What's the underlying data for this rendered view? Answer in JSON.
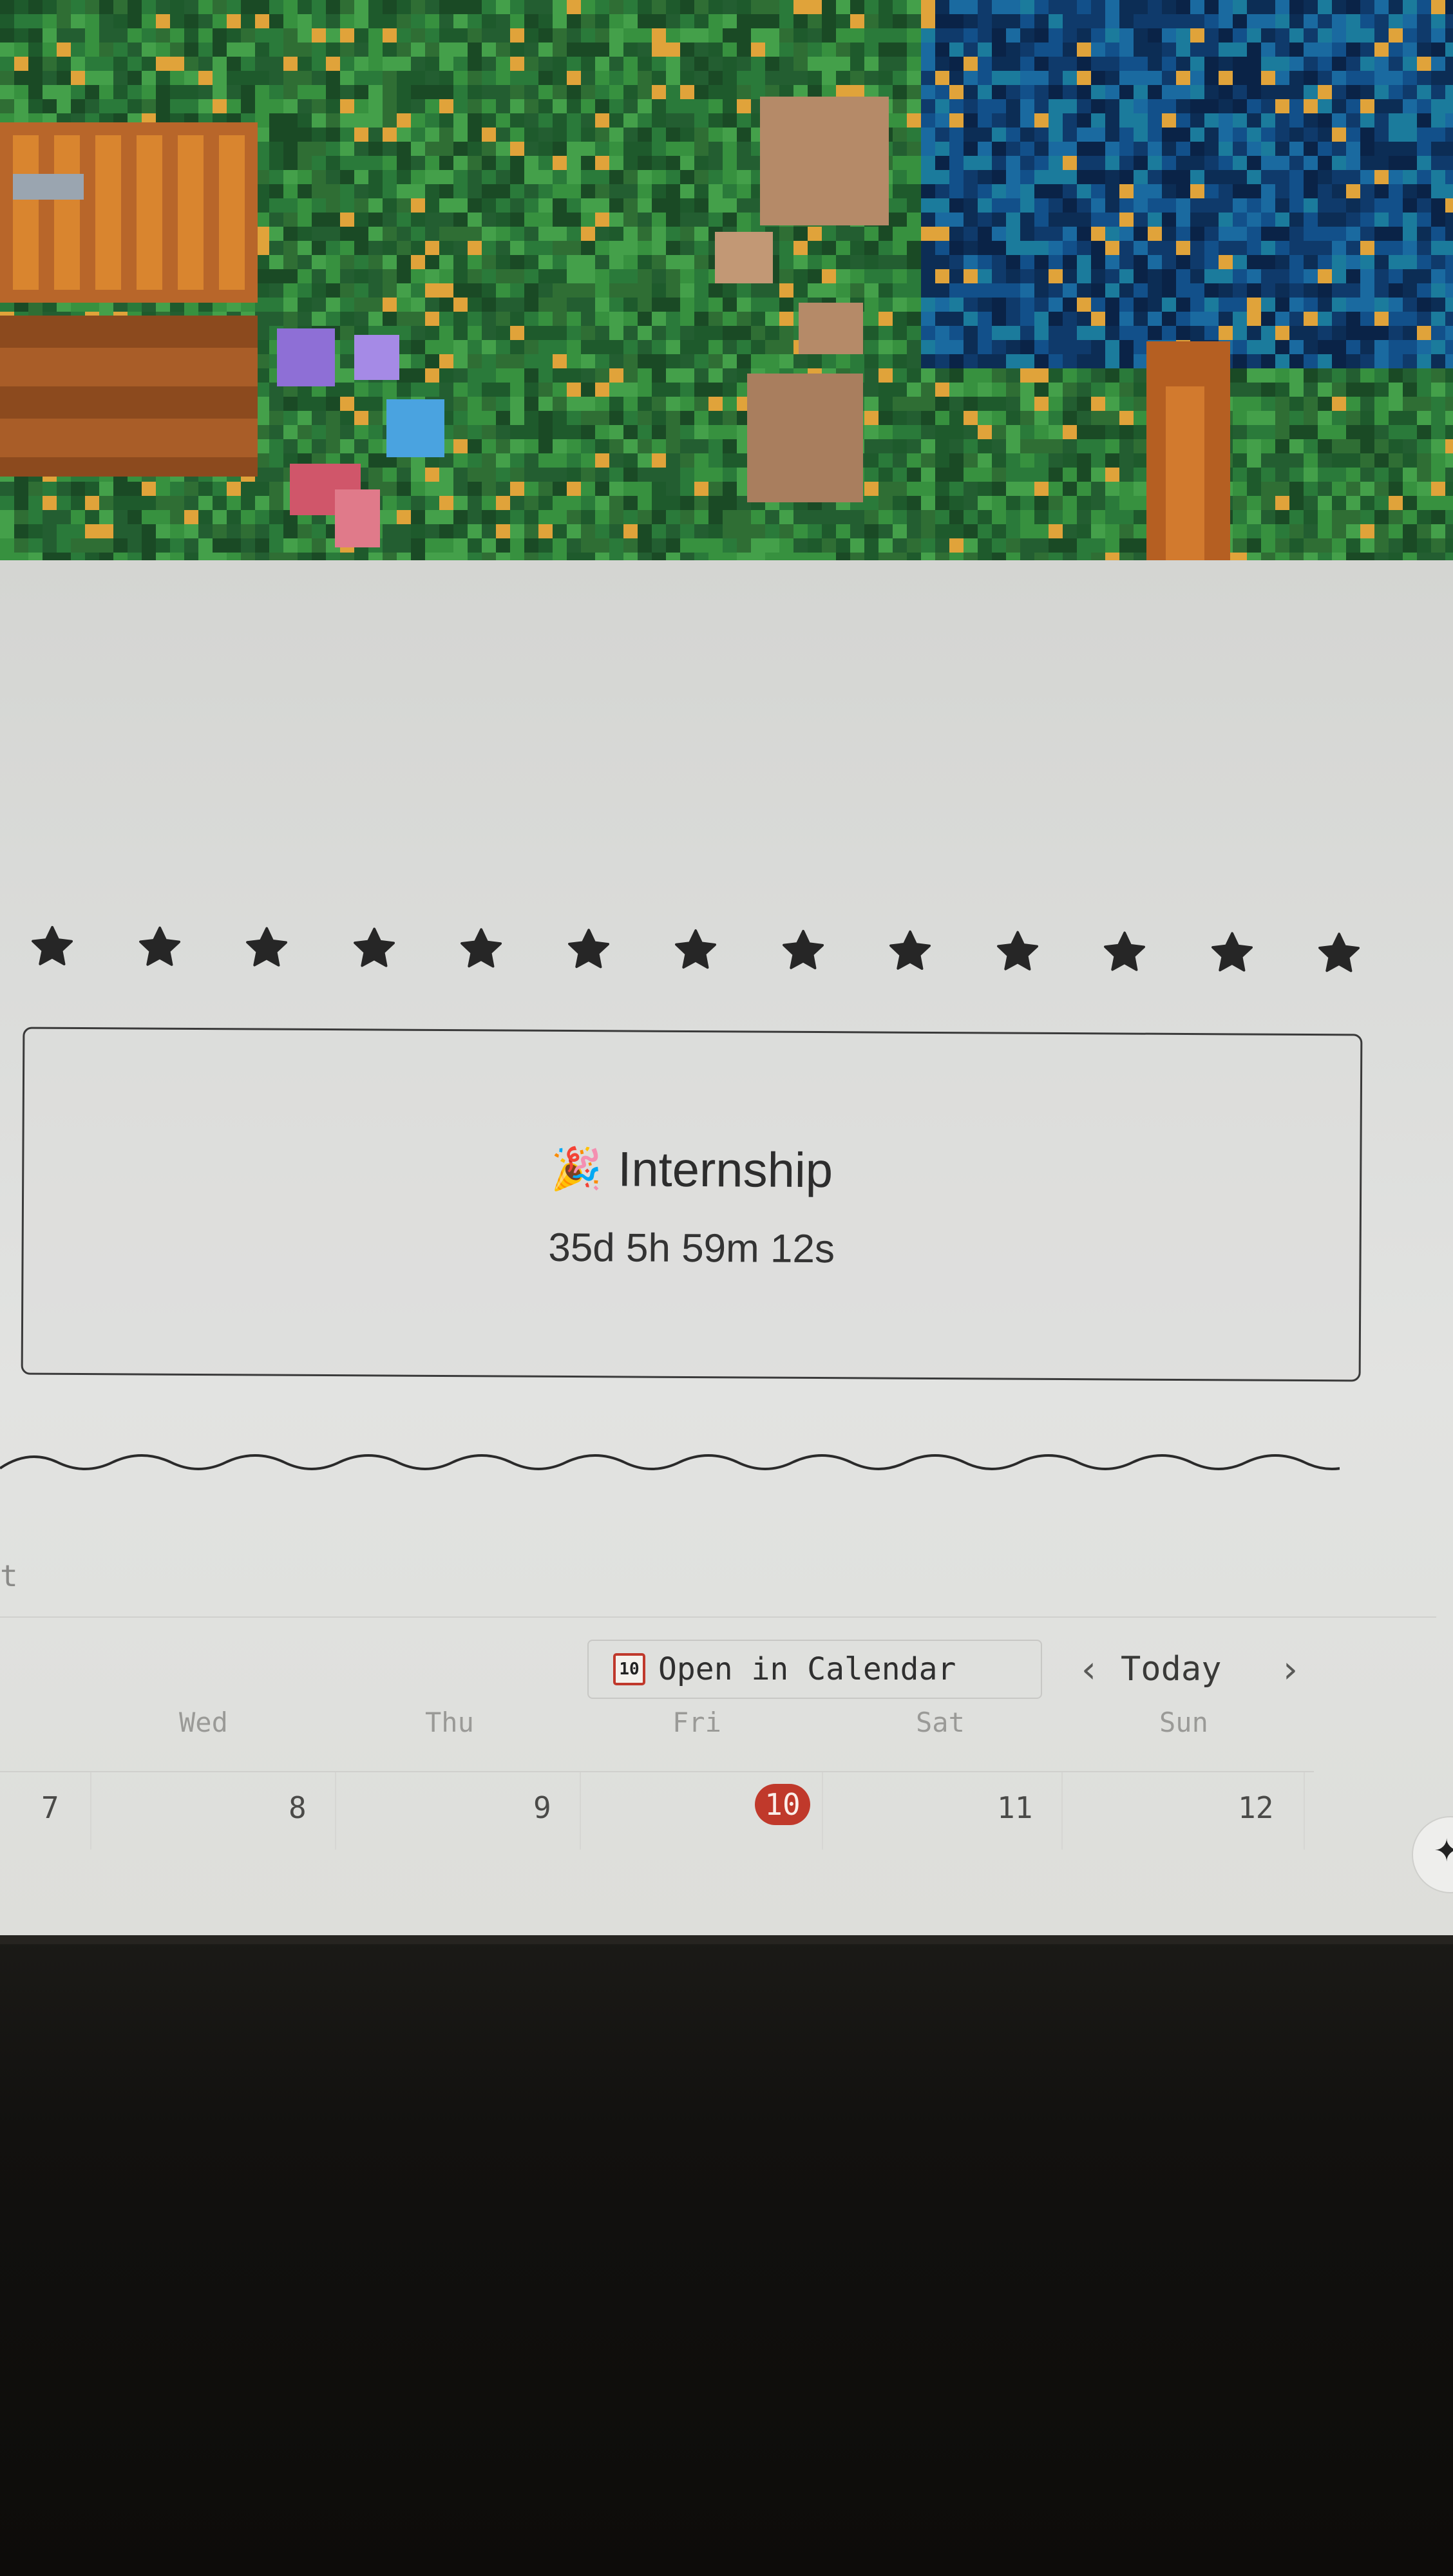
{
  "countdown": {
    "emoji": "🎉",
    "title": "Internship",
    "remaining": "35d 5h 59m 12s"
  },
  "calendar": {
    "partial_header": "t",
    "open_button": {
      "icon_day": "10",
      "label": "Open in Calendar"
    },
    "nav": {
      "prev": "‹",
      "today": "Today",
      "next": "›"
    },
    "weekdays": [
      "Wed",
      "Thu",
      "Fri",
      "Sat",
      "Sun"
    ],
    "days": [
      "7",
      "8",
      "9",
      "10",
      "11",
      "12"
    ],
    "today_day": "10",
    "accent": "#c0392b"
  },
  "ai_button": {
    "icon": "sparkle-icon",
    "glyph": "✦"
  },
  "divider": {
    "star_count": 13,
    "icon": "star-icon",
    "color": "#262626"
  }
}
